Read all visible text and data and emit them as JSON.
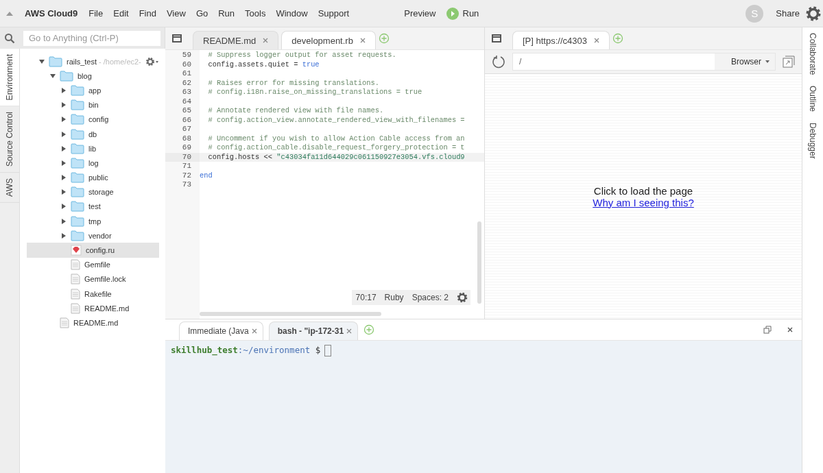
{
  "menubar": {
    "logo": "AWS Cloud9",
    "menus": [
      "File",
      "Edit",
      "Find",
      "View",
      "Go",
      "Run",
      "Tools",
      "Window",
      "Support"
    ],
    "preview": "Preview",
    "run": "Run",
    "avatar": "S",
    "share": "Share"
  },
  "left_rail": [
    {
      "label": "Environment",
      "selected": true
    },
    {
      "label": "Source Control",
      "selected": false
    },
    {
      "label": "AWS",
      "selected": false
    }
  ],
  "search": {
    "placeholder": "Go to Anything (Ctrl-P)"
  },
  "tree": [
    {
      "name": "rails_test",
      "path": "- /home/ec2-",
      "kind": "folder",
      "expanded": true,
      "selected": false,
      "children": [
        {
          "name": "blog",
          "kind": "folder",
          "expanded": true,
          "selected": false,
          "children": [
            {
              "name": "app",
              "kind": "folder",
              "expanded": false,
              "selected": false
            },
            {
              "name": "bin",
              "kind": "folder",
              "expanded": false,
              "selected": false
            },
            {
              "name": "config",
              "kind": "folder",
              "expanded": false,
              "selected": false
            },
            {
              "name": "db",
              "kind": "folder",
              "expanded": false,
              "selected": false
            },
            {
              "name": "lib",
              "kind": "folder",
              "expanded": false,
              "selected": false
            },
            {
              "name": "log",
              "kind": "folder",
              "expanded": false,
              "selected": false
            },
            {
              "name": "public",
              "kind": "folder",
              "expanded": false,
              "selected": false
            },
            {
              "name": "storage",
              "kind": "folder",
              "expanded": false,
              "selected": false
            },
            {
              "name": "test",
              "kind": "folder",
              "expanded": false,
              "selected": false
            },
            {
              "name": "tmp",
              "kind": "folder",
              "expanded": false,
              "selected": false
            },
            {
              "name": "vendor",
              "kind": "folder",
              "expanded": false,
              "selected": false
            },
            {
              "name": "config.ru",
              "kind": "ruby",
              "selected": true
            },
            {
              "name": "Gemfile",
              "kind": "file",
              "selected": false
            },
            {
              "name": "Gemfile.lock",
              "kind": "file",
              "selected": false
            },
            {
              "name": "Rakefile",
              "kind": "file",
              "selected": false
            },
            {
              "name": "README.md",
              "kind": "file",
              "selected": false
            }
          ]
        },
        {
          "name": "README.md",
          "kind": "file",
          "selected": false
        }
      ]
    }
  ],
  "editor": {
    "tabs": [
      {
        "label": "README.md",
        "selected": false
      },
      {
        "label": "development.rb",
        "selected": true
      }
    ],
    "lines": [
      {
        "number": "59",
        "current": false,
        "segments": [
          {
            "kind": "comment",
            "text": "  # Suppress logger output for asset requests."
          }
        ]
      },
      {
        "number": "60",
        "current": false,
        "segments": [
          {
            "kind": "plain",
            "text": "  config.assets.quiet = "
          },
          {
            "kind": "keyword",
            "text": "true"
          }
        ]
      },
      {
        "number": "61",
        "current": false
      },
      {
        "number": "62",
        "current": false,
        "segments": [
          {
            "kind": "comment",
            "text": "  # Raises error for missing translations."
          }
        ]
      },
      {
        "number": "63",
        "current": false,
        "segments": [
          {
            "kind": "comment",
            "text": "  # config.i18n.raise_on_missing_translations = true"
          }
        ]
      },
      {
        "number": "64",
        "current": false
      },
      {
        "number": "65",
        "current": false,
        "segments": [
          {
            "kind": "comment",
            "text": "  # Annotate rendered view with file names."
          }
        ]
      },
      {
        "number": "66",
        "current": false,
        "segments": [
          {
            "kind": "comment",
            "text": "  # config.action_view.annotate_rendered_view_with_filenames ="
          }
        ]
      },
      {
        "number": "67",
        "current": false
      },
      {
        "number": "68",
        "current": false,
        "segments": [
          {
            "kind": "comment",
            "text": "  # Uncomment if you wish to allow Action Cable access from an"
          }
        ]
      },
      {
        "number": "69",
        "current": false,
        "segments": [
          {
            "kind": "comment",
            "text": "  # config.action_cable.disable_request_forgery_protection = t"
          }
        ]
      },
      {
        "number": "70",
        "current": true,
        "segments": [
          {
            "kind": "plain",
            "text": "  config.hosts << "
          },
          {
            "kind": "string",
            "text": "\"c43034fa11d644029c061150927e3054.vfs.cloud9"
          }
        ]
      },
      {
        "number": "71",
        "current": false
      },
      {
        "number": "72",
        "current": false,
        "segments": [
          {
            "kind": "keyword",
            "text": "end"
          }
        ]
      },
      {
        "number": "73",
        "current": false
      }
    ],
    "status": {
      "position": "70:17",
      "mode": "Ruby",
      "indent": "Spaces: 2"
    }
  },
  "preview": {
    "tab": "[P] https://c4303",
    "url": "/",
    "browser": "Browser",
    "message": "Click to load the page",
    "link": "Why am I seeing this?"
  },
  "right_rail": [
    "Collaborate",
    "Outline",
    "Debugger"
  ],
  "terminal": {
    "tabs": [
      {
        "label": "Immediate (Java",
        "selected": false
      },
      {
        "label": "bash - \"ip-172-31",
        "selected": true
      }
    ],
    "user": "skillhub_test",
    "path": ":~/environment",
    "symbol": "$"
  }
}
